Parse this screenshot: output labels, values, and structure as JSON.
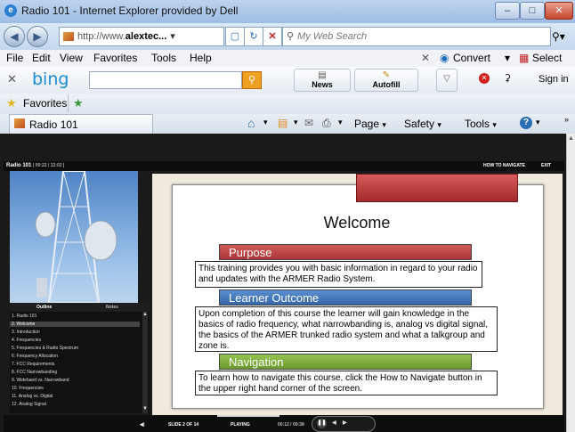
{
  "window": {
    "title": "Radio 101 - Internet Explorer provided by Dell"
  },
  "address": {
    "url_prefix": "http://www.",
    "url_domain": "alextec...",
    "search_placeholder": "My Web Search"
  },
  "menu": [
    "File",
    "Edit",
    "View",
    "Favorites",
    "Tools",
    "Help"
  ],
  "menu_right": {
    "convert": "Convert",
    "select": "Select"
  },
  "bing": {
    "logo": "bing",
    "news": "News",
    "autofill": "Autofill",
    "sign_in": "Sign in"
  },
  "favorites": {
    "label": "Favorites"
  },
  "tab": {
    "title": "Radio 101"
  },
  "commands": {
    "page": "Page",
    "safety": "Safety",
    "tools": "Tools"
  },
  "player": {
    "course": "Radio 101",
    "time": "| 00:22 / 12:02 |",
    "how_to_navigate": "HOW TO NAVIGATE",
    "exit": "EXIT",
    "tab_outline": "Outline",
    "tab_notes": "Notes",
    "outline": [
      "1. Radio 101",
      "2. Welcome",
      "3. Introduction",
      "4. Frequencies",
      "5. Frequencies & Radio Spectrum",
      "6. Frequency Allocation",
      "7. FCC Requirements",
      "8. FCC Narrowbanding",
      "9. Wideband vs. Narrowband",
      "10. Frequencies",
      "11. Analog vs. Digital",
      "12. Analog Signal"
    ],
    "slide_counter": "SLIDE 2 OF 14",
    "status": "PLAYING",
    "slide_time": "00:12 / 00:38"
  },
  "slide": {
    "title": "Welcome",
    "sections": [
      {
        "heading": "Purpose",
        "color": "#c0403f",
        "text": "This training provides you with basic information in regard to your radio and updates with the ARMER Radio System."
      },
      {
        "heading": "Learner Outcome",
        "color": "#3f74b8",
        "text": "Upon completion of this course the learner will gain knowledge in the basics of radio frequency, what narrowbanding is, analog vs digital signal, the basics of the ARMER trunked radio system and what a talkgroup and zone is."
      },
      {
        "heading": "Navigation",
        "color": "#7fae3a",
        "text": "To learn how to navigate this course, click the How to Navigate button in the upper right hand corner of the screen."
      }
    ]
  }
}
